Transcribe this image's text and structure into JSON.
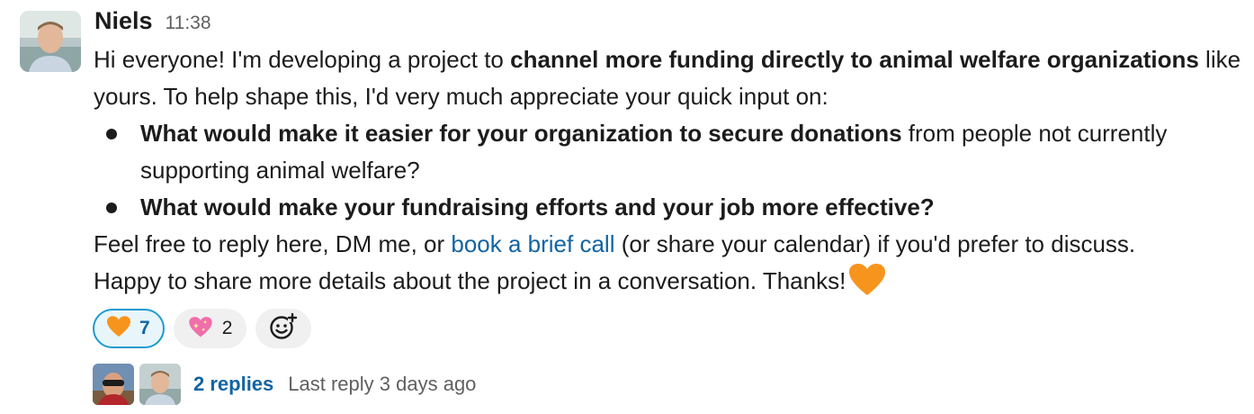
{
  "message": {
    "author": "Niels",
    "timestamp": "11:38",
    "intro": {
      "part1": "Hi everyone! I'm developing a project to ",
      "bold": "channel more funding directly to animal welfare organizations",
      "part2": " like yours. To help shape this, I'd very much appreciate your quick input on:"
    },
    "bullets": [
      {
        "bold": "What would make it easier for your organization to secure donations",
        "rest": " from people not currently supporting animal welfare?"
      },
      {
        "bold": "What would make your fundraising efforts and your job more effective?",
        "rest": ""
      }
    ],
    "closing": {
      "part1": "Feel free to reply here, DM me, or ",
      "link": "book a brief call",
      "part2": " (or share your calendar) if you'd prefer to discuss.",
      "line2": "Happy to share more details about the project in a conversation. Thanks!",
      "emoji": "orange-heart"
    }
  },
  "reactions": [
    {
      "emoji": "orange-heart",
      "count": "7",
      "active": true
    },
    {
      "emoji": "sparkling-heart",
      "count": "2",
      "active": false
    }
  ],
  "add_reaction_icon": "add-emoji-icon",
  "thread": {
    "replies": "2 replies",
    "last_reply": "Last reply 3 days ago"
  },
  "colors": {
    "link": "#1264a3",
    "active_reaction_border": "#1d9bd1",
    "active_reaction_bg": "#e8f5fa",
    "orange_heart": "#f7941d",
    "muted_text": "#616061"
  }
}
